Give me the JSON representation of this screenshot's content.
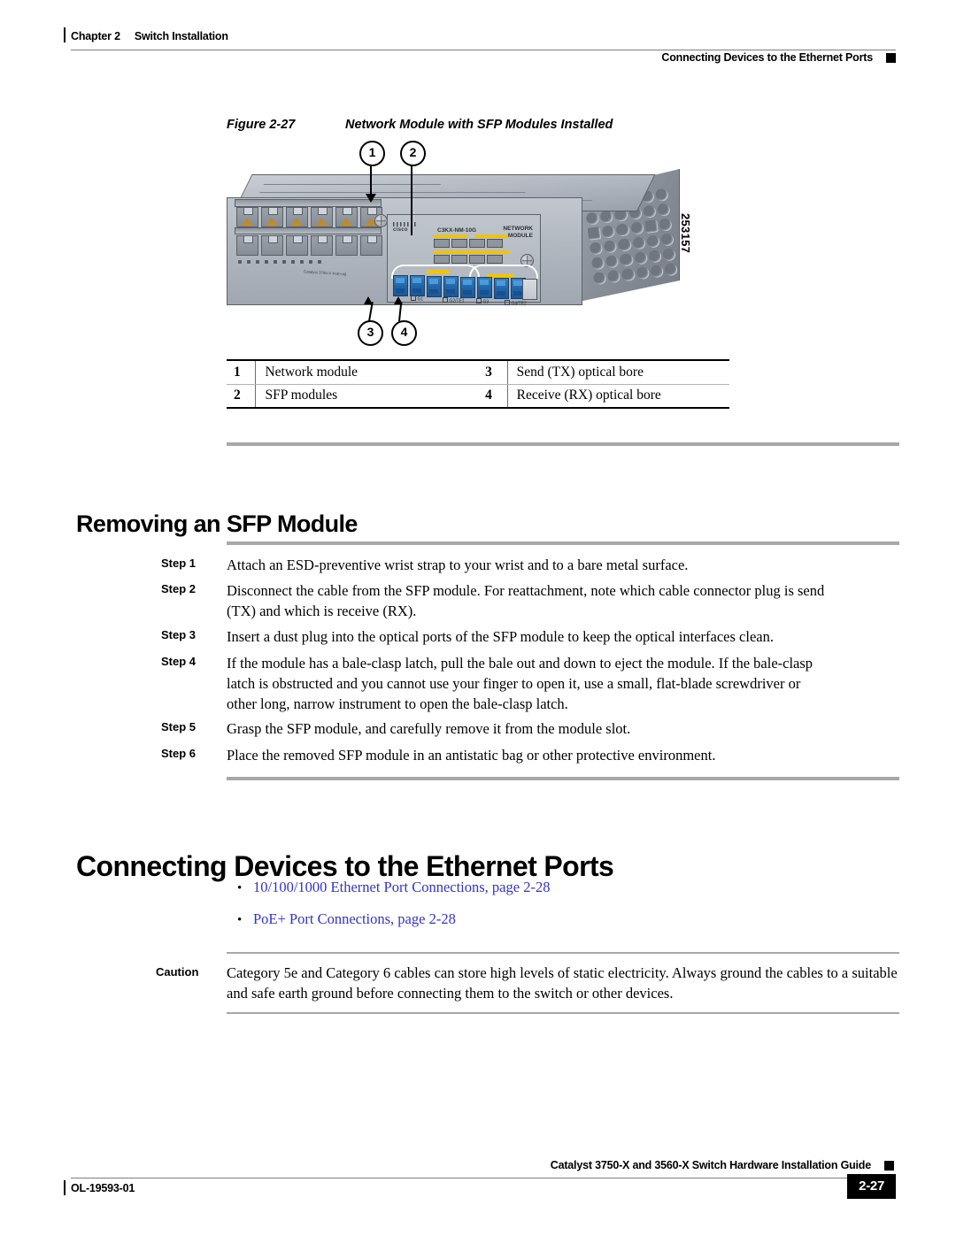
{
  "header": {
    "chapter": "Chapter 2",
    "chapter_title": "Switch Installation",
    "section": "Connecting Devices to the Ethernet Ports"
  },
  "figure": {
    "number": "Figure 2-27",
    "title": "Network Module with SFP Modules Installed",
    "art_id": "253157",
    "callouts": [
      "1",
      "2",
      "3",
      "4"
    ],
    "device": {
      "brand": "cisco",
      "module_part": "C3KX-NM-10G",
      "module_title_line1": "NETWORK",
      "module_title_line2": "MODULE",
      "chassis_label": "Catalyst 3750-X PoE+48",
      "port_labels": [
        "G1",
        "G2/TE1",
        "G3",
        "G4/TE2"
      ]
    },
    "legend": {
      "rows": [
        {
          "n1": "1",
          "t1": "Network module",
          "n2": "3",
          "t2": "Send (TX) optical bore"
        },
        {
          "n1": "2",
          "t1": "SFP modules",
          "n2": "4",
          "t2": "Receive (RX) optical bore"
        }
      ]
    }
  },
  "sections": {
    "removing_sfp": {
      "heading": "Removing an SFP Module",
      "steps": [
        {
          "label": "Step 1",
          "text": "Attach an ESD-preventive wrist strap to your wrist and to a bare metal surface."
        },
        {
          "label": "Step 2",
          "text": "Disconnect the cable from the SFP module. For reattachment, note which cable connector plug is send (TX) and which is receive (RX)."
        },
        {
          "label": "Step 3",
          "text": "Insert a dust plug into the optical ports of the SFP module to keep the optical interfaces clean."
        },
        {
          "label": "Step 4",
          "text": "If the module has a bale-clasp latch, pull the bale out and down to eject the module. If the bale-clasp latch is obstructed and you cannot use your finger to open it, use a small, flat-blade screwdriver or other long, narrow instrument to open the bale-clasp latch."
        },
        {
          "label": "Step 5",
          "text": "Grasp the SFP module, and carefully remove it from the module slot."
        },
        {
          "label": "Step 6",
          "text": "Place the removed SFP module in an antistatic bag or other protective environment."
        }
      ]
    },
    "connecting_devices": {
      "heading": "Connecting Devices to the Ethernet Ports",
      "links": [
        "10/100/1000 Ethernet Port Connections, page 2-28",
        "PoE+ Port Connections, page 2-28"
      ],
      "link_color": "#3333CC"
    },
    "caution": {
      "label": "Caution",
      "text": "Category 5e and Category 6 cables can store high levels of static electricity. Always ground the cables to a suitable and safe earth ground before connecting them to the switch or other devices."
    }
  },
  "footer": {
    "doc_id": "OL-19593-01",
    "guide_title": "Catalyst 3750-X and 3560-X Switch Hardware Installation Guide",
    "page_number": "2-27"
  }
}
